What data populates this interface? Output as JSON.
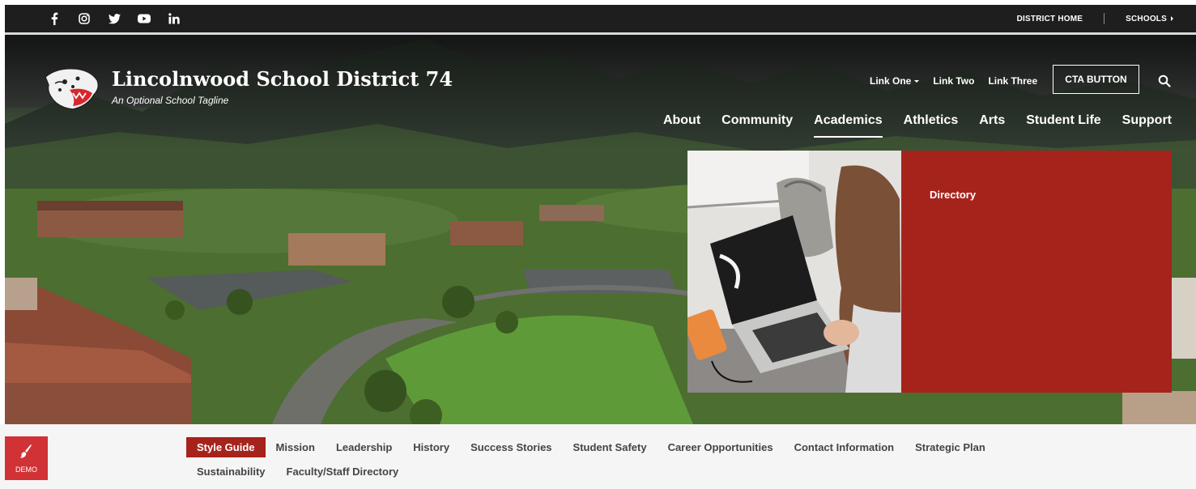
{
  "topbar": {
    "social_icons": [
      "facebook-icon",
      "instagram-icon",
      "twitter-icon",
      "youtube-icon",
      "linkedin-icon"
    ],
    "district_home": "DISTRICT HOME",
    "schools": "SCHOOLS"
  },
  "header": {
    "title": "Lincolnwood School District 74",
    "tagline": "An Optional School Tagline",
    "quick_links": [
      "Link One",
      "Link Two",
      "Link Three"
    ],
    "cta": "CTA BUTTON"
  },
  "main_nav": {
    "items": [
      "About",
      "Community",
      "Academics",
      "Athletics",
      "Arts",
      "Student Life",
      "Support"
    ],
    "active": "Academics"
  },
  "dropdown": {
    "links": [
      "Directory"
    ]
  },
  "subnav": {
    "demo_label": "DEMO",
    "row1": [
      "Style Guide",
      "Mission",
      "Leadership",
      "History",
      "Success Stories",
      "Student Safety",
      "Career Opportunities",
      "Contact Information",
      "Strategic Plan"
    ],
    "row2": [
      "Sustainability",
      "Faculty/Staff Directory"
    ],
    "active": "Style Guide"
  },
  "colors": {
    "topbar": "#1e1e1e",
    "accent_red": "#a6231c",
    "demo_red": "#d03236",
    "subnav_bg": "#f5f5f5"
  }
}
